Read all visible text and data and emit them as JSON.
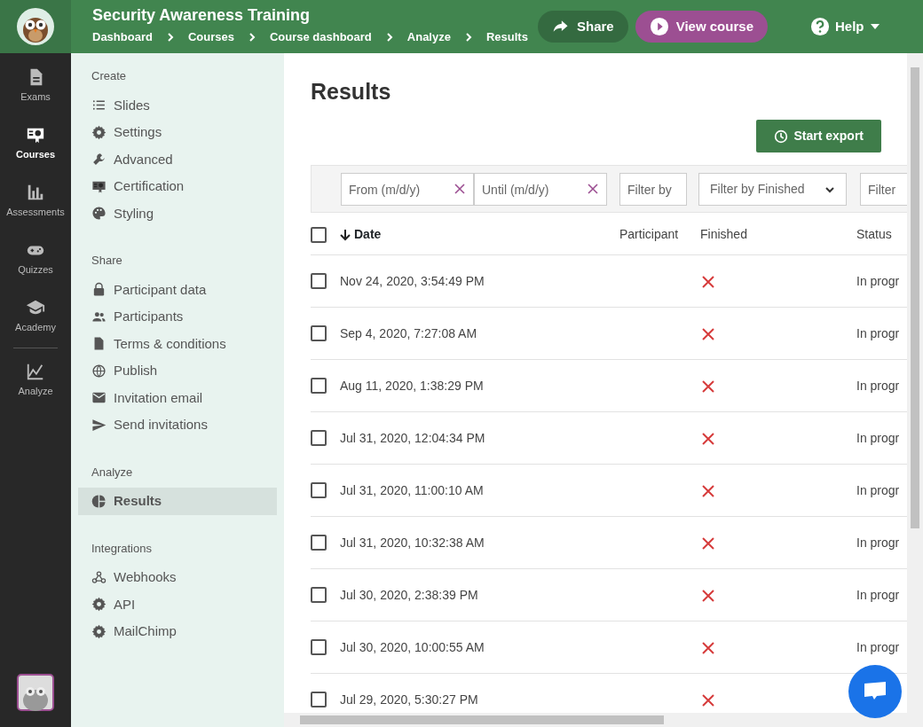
{
  "app": {
    "title": "Security Awareness Training",
    "breadcrumbs": [
      "Dashboard",
      "Courses",
      "Course dashboard",
      "Analyze",
      "Results"
    ]
  },
  "header_actions": {
    "share": "Share",
    "view_course": "View course",
    "help": "Help"
  },
  "rail": [
    {
      "label": "Exams",
      "selected": false
    },
    {
      "label": "Courses",
      "selected": true
    },
    {
      "label": "Assessments",
      "selected": false
    },
    {
      "label": "Quizzes",
      "selected": false
    },
    {
      "label": "Academy",
      "selected": false
    },
    {
      "label": "Analyze",
      "selected": false
    }
  ],
  "menu": [
    {
      "heading": "Create",
      "items": [
        {
          "label": "Slides",
          "selected": false
        },
        {
          "label": "Settings",
          "selected": false
        },
        {
          "label": "Advanced",
          "selected": false
        },
        {
          "label": "Certification",
          "selected": false
        },
        {
          "label": "Styling",
          "selected": false
        }
      ]
    },
    {
      "heading": "Share",
      "items": [
        {
          "label": "Participant data",
          "selected": false
        },
        {
          "label": "Participants",
          "selected": false
        },
        {
          "label": "Terms & conditions",
          "selected": false
        },
        {
          "label": "Publish",
          "selected": false
        },
        {
          "label": "Invitation email",
          "selected": false
        },
        {
          "label": "Send invitations",
          "selected": false
        }
      ]
    },
    {
      "heading": "Analyze",
      "items": [
        {
          "label": "Results",
          "selected": true
        }
      ]
    },
    {
      "heading": "Integrations",
      "items": [
        {
          "label": "Webhooks",
          "selected": false
        },
        {
          "label": "API",
          "selected": false
        },
        {
          "label": "MailChimp",
          "selected": false
        }
      ]
    }
  ],
  "page": {
    "title": "Results",
    "export_button": "Start export"
  },
  "filters": [
    {
      "kind": "date",
      "placeholder": "From (m/d/y)"
    },
    {
      "kind": "date",
      "placeholder": "Until (m/d/y)"
    },
    {
      "kind": "text",
      "placeholder": "Filter by"
    },
    {
      "kind": "select",
      "value": "Filter by Finished"
    },
    {
      "kind": "text",
      "placeholder": "Filter"
    }
  ],
  "table": {
    "all_checked": false,
    "columns": [
      {
        "label": "Date",
        "sorted": true
      },
      {
        "label": "Participant",
        "sorted": false
      },
      {
        "label": "Finished",
        "sorted": false
      },
      {
        "label": "Status",
        "sorted": false
      }
    ],
    "rows": [
      {
        "date": "Nov 24, 2020, 3:54:49 PM",
        "finished": false,
        "status": "In progr",
        "checked": false
      },
      {
        "date": "Sep 4, 2020, 7:27:08 AM",
        "finished": false,
        "status": "In progr",
        "checked": false
      },
      {
        "date": "Aug 11, 2020, 1:38:29 PM",
        "finished": false,
        "status": "In progr",
        "checked": false
      },
      {
        "date": "Jul 31, 2020, 12:04:34 PM",
        "finished": false,
        "status": "In progr",
        "checked": false
      },
      {
        "date": "Jul 31, 2020, 11:00:10 AM",
        "finished": false,
        "status": "In progr",
        "checked": false
      },
      {
        "date": "Jul 31, 2020, 10:32:38 AM",
        "finished": false,
        "status": "In progr",
        "checked": false
      },
      {
        "date": "Jul 30, 2020, 2:38:39 PM",
        "finished": false,
        "status": "In progr",
        "checked": false
      },
      {
        "date": "Jul 30, 2020, 10:00:55 AM",
        "finished": false,
        "status": "In progr",
        "checked": false
      },
      {
        "date": "Jul 29, 2020, 5:30:27 PM",
        "finished": false,
        "checked": false
      }
    ]
  }
}
